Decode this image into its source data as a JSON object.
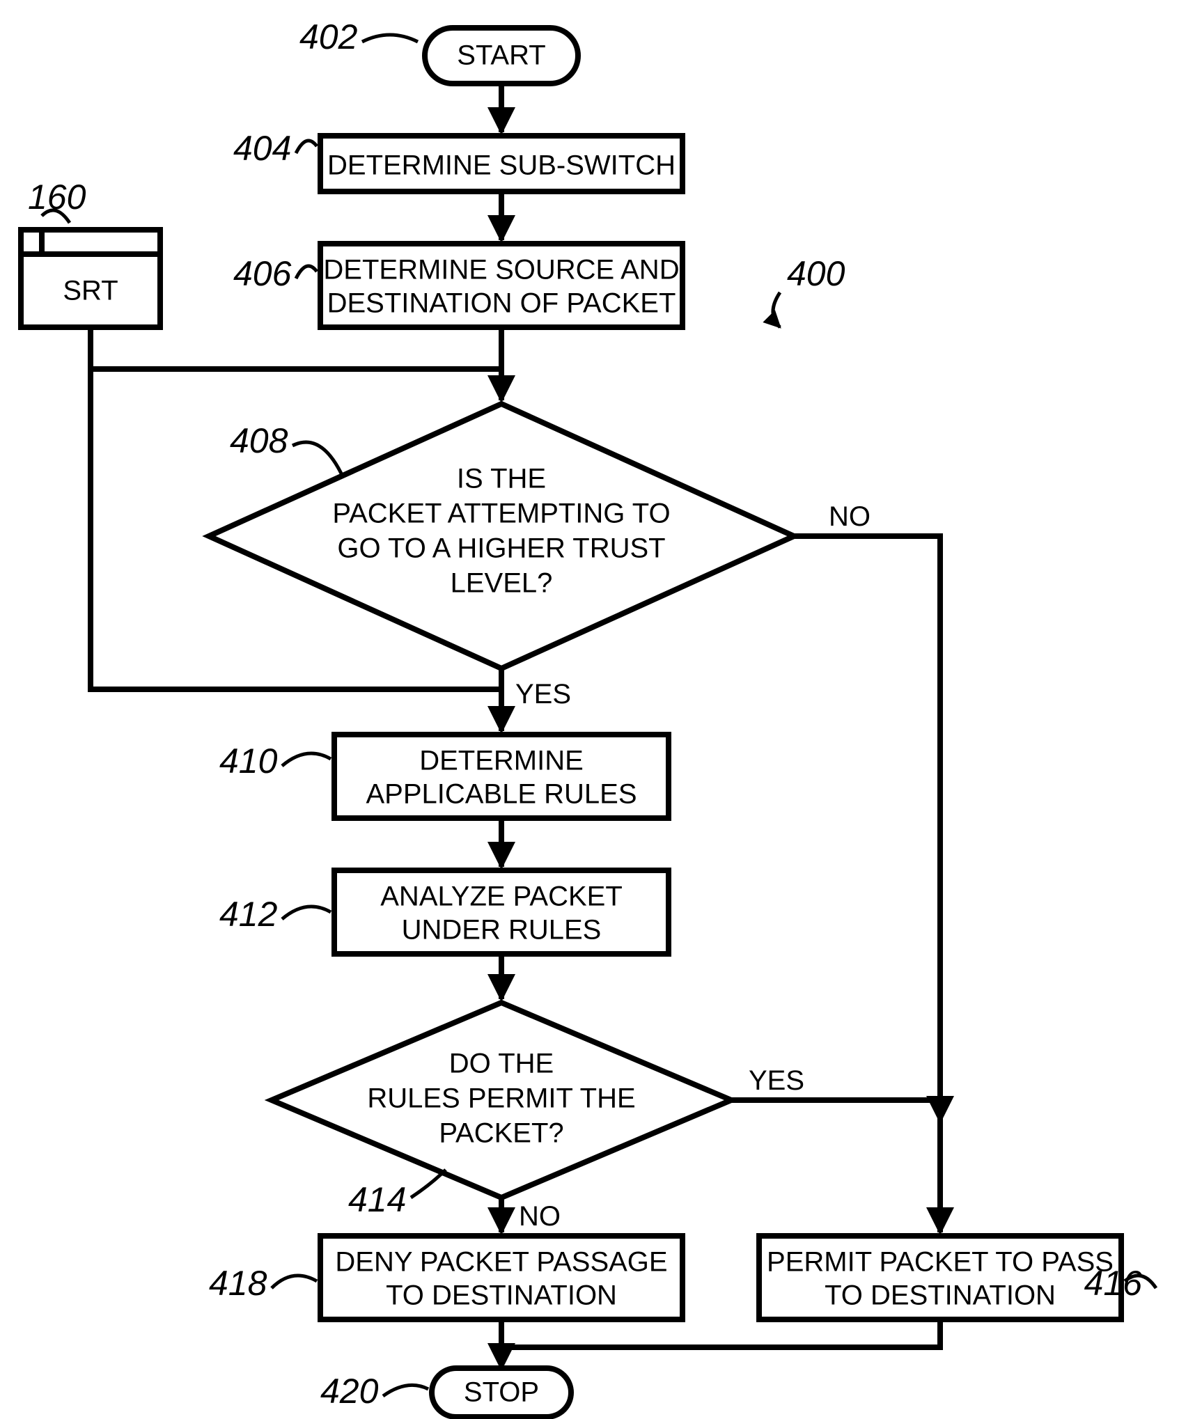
{
  "labels": {
    "l402": "402",
    "l404": "404",
    "l160": "160",
    "l406": "406",
    "l400": "400",
    "l408": "408",
    "l410": "410",
    "l412": "412",
    "l414": "414",
    "l416": "416",
    "l418": "418",
    "l420": "420"
  },
  "nodes": {
    "start": "START",
    "srt": "SRT",
    "n404": "DETERMINE SUB-SWITCH",
    "n406_l1": "DETERMINE SOURCE AND",
    "n406_l2": "DESTINATION OF PACKET",
    "n408_l1": "IS THE",
    "n408_l2": "PACKET ATTEMPTING TO",
    "n408_l3": "GO TO A HIGHER TRUST",
    "n408_l4": "LEVEL?",
    "n410_l1": "DETERMINE",
    "n410_l2": "APPLICABLE RULES",
    "n412_l1": "ANALYZE PACKET",
    "n412_l2": "UNDER RULES",
    "n414_l1": "DO THE",
    "n414_l2": "RULES PERMIT THE",
    "n414_l3": "PACKET?",
    "n416_l1": "PERMIT PACKET TO PASS",
    "n416_l2": "TO DESTINATION",
    "n418_l1": "DENY PACKET PASSAGE",
    "n418_l2": "TO DESTINATION",
    "stop": "STOP"
  },
  "paths": {
    "yes": "YES",
    "no": "NO"
  }
}
